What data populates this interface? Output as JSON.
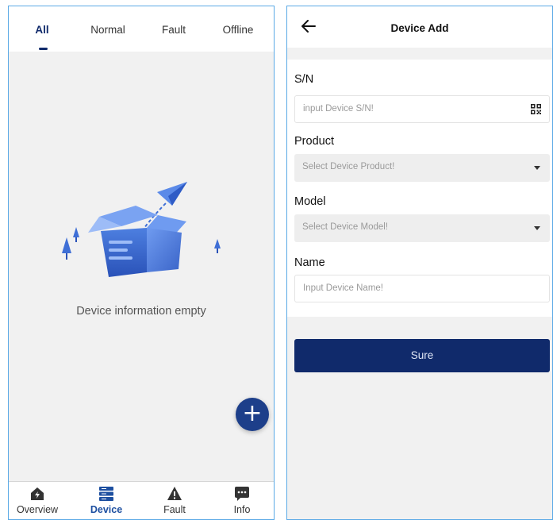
{
  "device_list": {
    "tabs": [
      {
        "label": "All",
        "active": true
      },
      {
        "label": "Normal",
        "active": false
      },
      {
        "label": "Fault",
        "active": false
      },
      {
        "label": "Offline",
        "active": false
      }
    ],
    "empty_message": "Device information empty",
    "fab_icon": "plus-icon",
    "fab_symbol": "+",
    "bottom_nav": [
      {
        "label": "Overview",
        "icon": "home-bolt-icon",
        "active": false
      },
      {
        "label": "Device",
        "icon": "server-stack-icon",
        "active": true
      },
      {
        "label": "Fault",
        "icon": "warning-triangle-icon",
        "active": false
      },
      {
        "label": "Info",
        "icon": "chat-bubble-icon",
        "active": false
      }
    ]
  },
  "device_add": {
    "title": "Device Add",
    "back_icon": "back-arrow-icon",
    "fields": {
      "sn": {
        "label": "S/N",
        "placeholder": "input Device S/N!",
        "icon": "qr-scan-icon"
      },
      "product": {
        "label": "Product",
        "placeholder": "Select Device Product!"
      },
      "model": {
        "label": "Model",
        "placeholder": "Select Device Model!"
      },
      "name": {
        "label": "Name",
        "placeholder": "Input Device Name!"
      }
    },
    "submit_label": "Sure"
  },
  "colors": {
    "primary": "#102a6b",
    "accent": "#1d4fa0",
    "background": "#f1f1f1"
  }
}
